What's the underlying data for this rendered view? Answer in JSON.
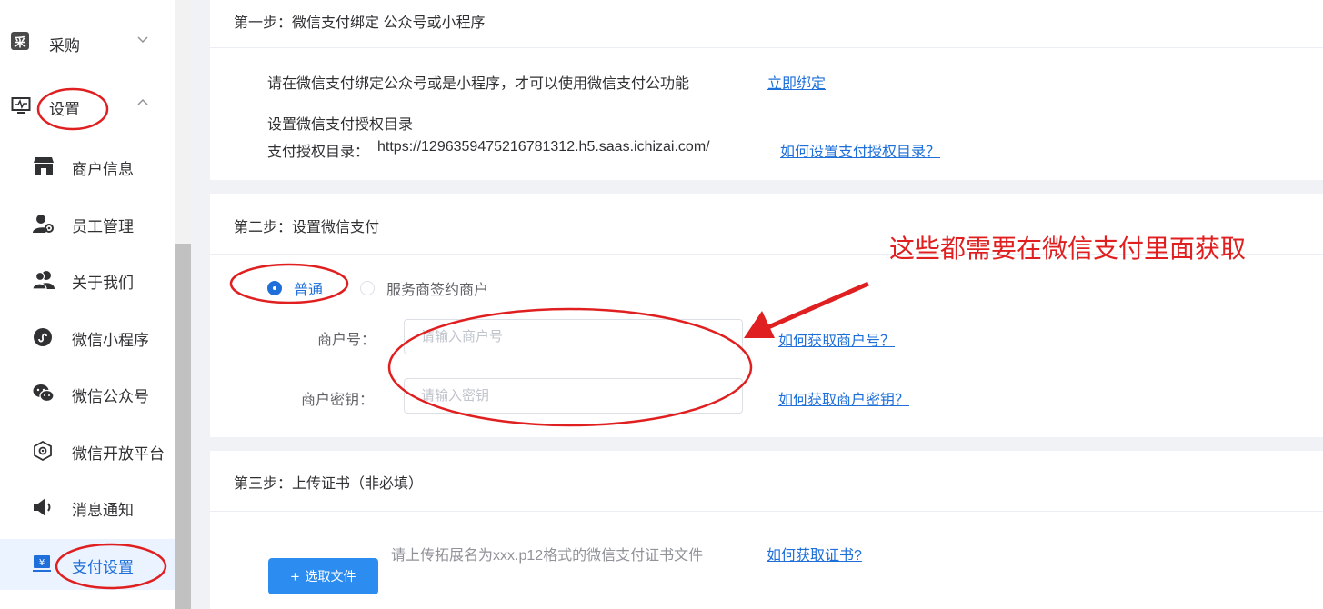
{
  "sidebar": {
    "groups": [
      {
        "label": "采购",
        "icon_text": "采",
        "icon": "purchase-icon",
        "arrow": "chevron-down"
      },
      {
        "label": "设置",
        "icon": "monitor-icon",
        "arrow": "chevron-up"
      }
    ],
    "items": [
      {
        "label": "商户信息",
        "icon": "store-icon"
      },
      {
        "label": "员工管理",
        "icon": "user-gear-icon"
      },
      {
        "label": "关于我们",
        "icon": "people-icon"
      },
      {
        "label": "微信小程序",
        "icon": "mini-program-icon"
      },
      {
        "label": "微信公众号",
        "icon": "wechat-icon"
      },
      {
        "label": "微信开放平台",
        "icon": "open-platform-icon"
      },
      {
        "label": "消息通知",
        "icon": "speaker-icon"
      },
      {
        "label": "支付设置",
        "icon": "payment-icon",
        "active": true
      }
    ]
  },
  "step1": {
    "title": "第一步：微信支付绑定 公众号或小程序",
    "bind_text": "请在微信支付绑定公众号或是小程序，才可以使用微信支付公功能",
    "bind_link": "立即绑定",
    "auth_title": "设置微信支付授权目录",
    "auth_dir_label": "支付授权目录：",
    "auth_dir_value": "https://129635947521678131 2.h5.saas.ichizai.com/",
    "auth_link": "如何设置支付授权目录？"
  },
  "step2": {
    "title": "第二步：设置微信支付",
    "radio_normal": "普通",
    "radio_service": "服务商签约商户",
    "merchant_no_label": "商户号：",
    "merchant_no_placeholder": "请输入商户号",
    "merchant_no_link": "如何获取商户号？",
    "merchant_key_label": "商户密钥：",
    "merchant_key_placeholder": "请输入密钥",
    "merchant_key_link": "如何获取商户密钥？"
  },
  "step3": {
    "title": "第三步：上传证书（非必填）",
    "hint": "请上传拓展名为xxx.p12格式的微信支付证书文件",
    "link": "如何获取证书?",
    "button": "选取文件",
    "button_icon": "plus-icon"
  },
  "annotation": {
    "text": "这些都需要在微信支付里面获取",
    "color": "#e02020"
  }
}
